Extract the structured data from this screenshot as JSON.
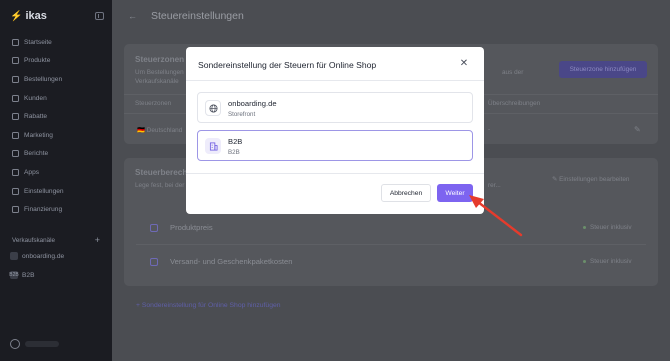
{
  "sidebar": {
    "logo": "ikas",
    "items": [
      {
        "label": "Startseite",
        "icon": "home-icon"
      },
      {
        "label": "Produkte",
        "icon": "box-icon"
      },
      {
        "label": "Bestellungen",
        "icon": "cart-icon"
      },
      {
        "label": "Kunden",
        "icon": "user-icon"
      },
      {
        "label": "Rabatte",
        "icon": "tag-icon"
      },
      {
        "label": "Marketing",
        "icon": "megaphone-icon"
      },
      {
        "label": "Berichte",
        "icon": "chart-icon"
      },
      {
        "label": "Apps",
        "icon": "apps-icon"
      },
      {
        "label": "Einstellungen",
        "icon": "gear-icon"
      },
      {
        "label": "Finanzierung",
        "icon": "finance-icon"
      }
    ],
    "sales_channels_label": "Verkaufskanäle",
    "channels": [
      {
        "label": "onboarding.de",
        "initials": ""
      },
      {
        "label": "B2B",
        "initials": "B2B"
      }
    ]
  },
  "page": {
    "title": "Steuereinstellungen",
    "zones_title": "Steuerzonen",
    "zones_desc_1": "Um Bestellungen",
    "zones_desc_end": "aus der",
    "zones_desc_2": "Verkaufskanäle",
    "add_tax_button": "Steuerzone hinzufügen",
    "col_zones": "Steuerzonen",
    "col_overrides": "Überschreibungen",
    "zone_row": "🇩🇪 Deutschland",
    "zone_row_dash": "-",
    "calc_title": "Steuerberechnung",
    "calc_desc": "Lege fest, bei der Steu",
    "calc_desc_end": "rer...",
    "edit_settings": "Einstellungen bearbeiten",
    "rows": [
      {
        "label": "Produktpreis",
        "status": "Steuer inklusiv"
      },
      {
        "label": "Versand- und Geschenkpaketkosten",
        "status": "Steuer inklusiv"
      }
    ],
    "add_special_link": "+ Sondereinstellung für Online Shop hinzufügen"
  },
  "modal": {
    "title": "Sondereinstellung der Steuern für Online Shop",
    "options": [
      {
        "name": "onboarding.de",
        "sub": "Storefront",
        "icon": "globe-icon",
        "selected": false
      },
      {
        "name": "B2B",
        "sub": "B2B",
        "icon": "building-icon",
        "selected": true
      }
    ],
    "cancel_label": "Abbrechen",
    "next_label": "Weiter"
  },
  "colors": {
    "accent": "#7d64f0",
    "annotation_arrow": "#e53b2c"
  }
}
